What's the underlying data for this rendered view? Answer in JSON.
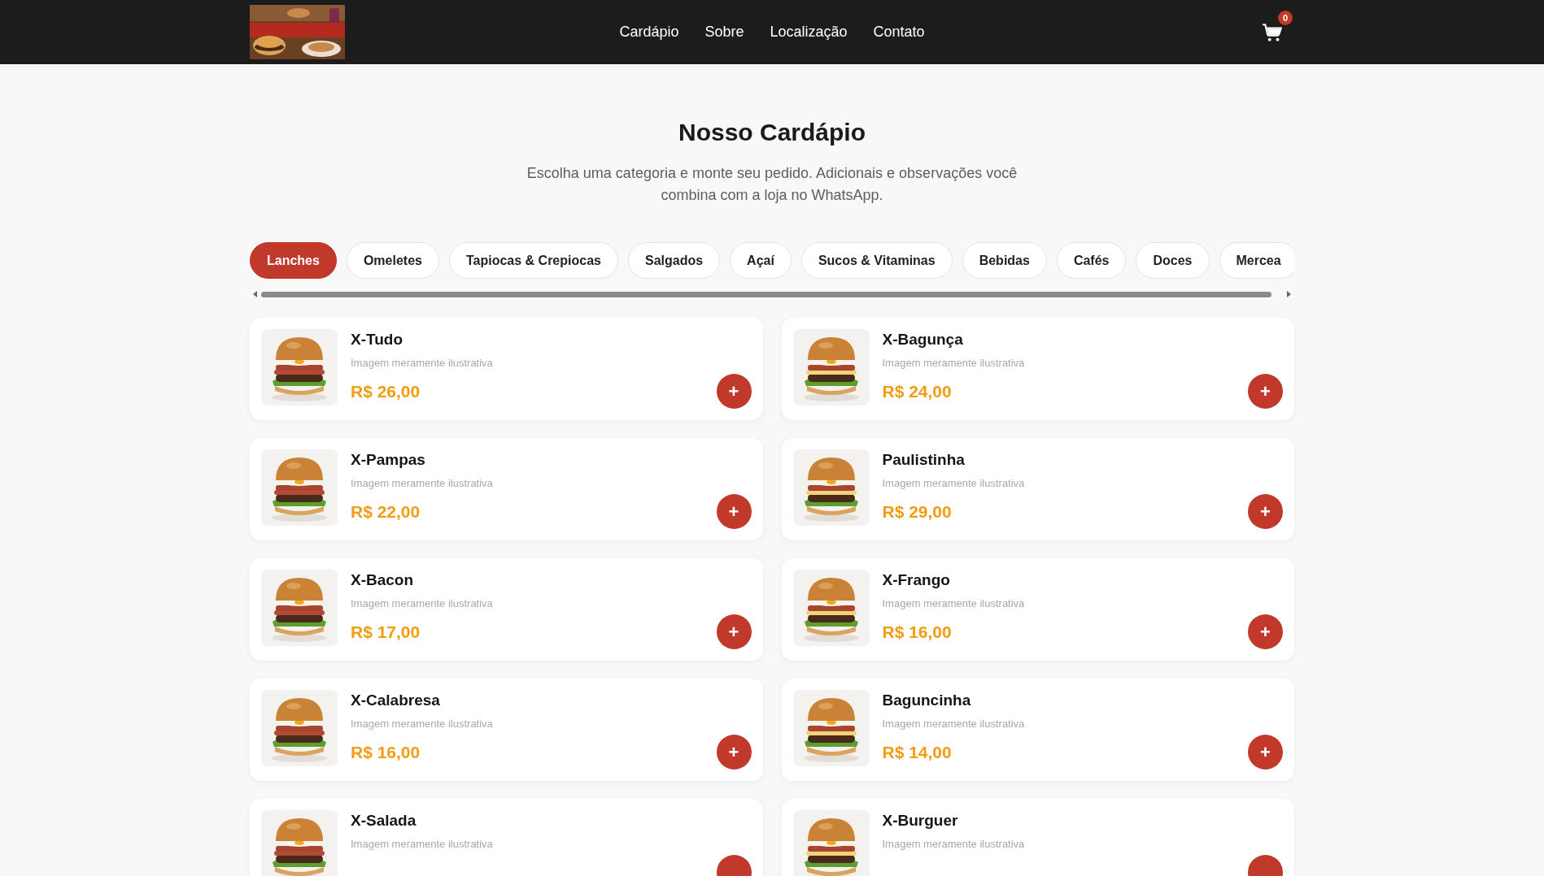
{
  "header": {
    "nav": [
      "Cardápio",
      "Sobre",
      "Localização",
      "Contato"
    ],
    "cart_count": "0"
  },
  "hero": {
    "title": "Nosso Cardápio",
    "subtitle": "Escolha uma categoria e monte seu pedido. Adicionais e observações você combina com a loja no WhatsApp."
  },
  "categories": [
    {
      "label": "Lanches",
      "selected": true
    },
    {
      "label": "Omeletes",
      "selected": false
    },
    {
      "label": "Tapiocas & Crepiocas",
      "selected": false
    },
    {
      "label": "Salgados",
      "selected": false
    },
    {
      "label": "Açaí",
      "selected": false
    },
    {
      "label": "Sucos & Vitaminas",
      "selected": false
    },
    {
      "label": "Bebidas",
      "selected": false
    },
    {
      "label": "Cafés",
      "selected": false
    },
    {
      "label": "Doces",
      "selected": false
    },
    {
      "label": "Mercea",
      "selected": false
    }
  ],
  "products": [
    {
      "name": "X-Tudo",
      "note": "Imagem meramente ilustrativa",
      "price": "R$ 26,00",
      "add": "+"
    },
    {
      "name": "X-Bagunça",
      "note": "Imagem meramente ilustrativa",
      "price": "R$ 24,00",
      "add": "+"
    },
    {
      "name": "X-Pampas",
      "note": "Imagem meramente ilustrativa",
      "price": "R$ 22,00",
      "add": "+"
    },
    {
      "name": "Paulistinha",
      "note": "Imagem meramente ilustrativa",
      "price": "R$ 29,00",
      "add": "+"
    },
    {
      "name": "X-Bacon",
      "note": "Imagem meramente ilustrativa",
      "price": "R$ 17,00",
      "add": "+"
    },
    {
      "name": "X-Frango",
      "note": "Imagem meramente ilustrativa",
      "price": "R$ 16,00",
      "add": "+"
    },
    {
      "name": "X-Calabresa",
      "note": "Imagem meramente ilustrativa",
      "price": "R$ 16,00",
      "add": "+"
    },
    {
      "name": "Baguncinha",
      "note": "Imagem meramente ilustrativa",
      "price": "R$ 14,00",
      "add": "+"
    },
    {
      "name": "X-Salada",
      "note": "Imagem meramente ilustrativa"
    },
    {
      "name": "X-Burguer",
      "note": "Imagem meramente ilustrativa"
    }
  ]
}
